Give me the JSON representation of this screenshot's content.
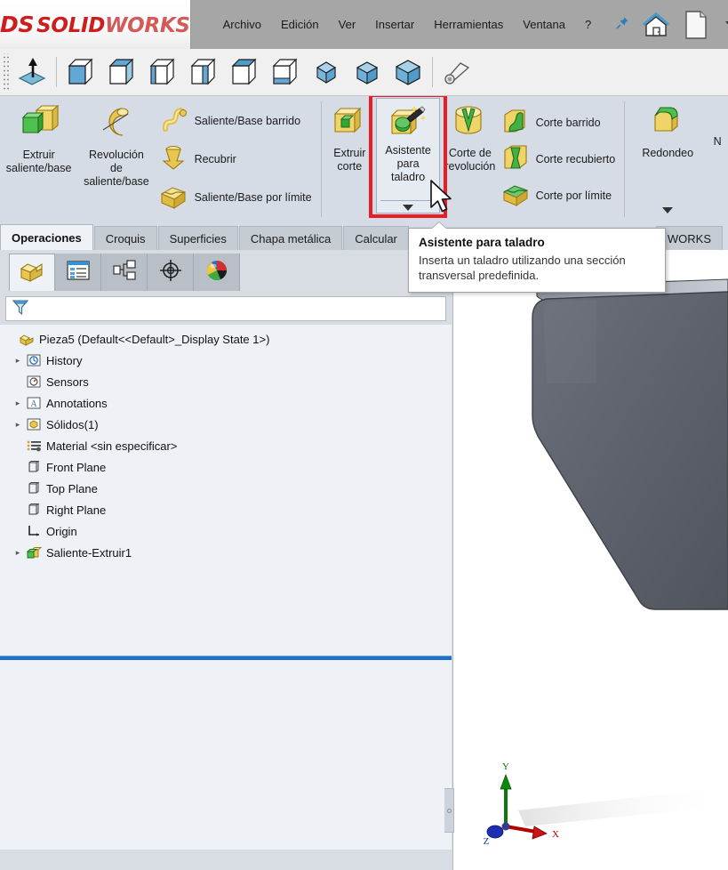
{
  "app": {
    "brand_ds": "DS",
    "brand_solid": "SOLID",
    "brand_works": "WORKS",
    "accent_red": "#cf1c1c",
    "highlight_red": "#ec1c24"
  },
  "menu": {
    "items": [
      {
        "label": "Archivo",
        "name": "menu-archivo"
      },
      {
        "label": "Edición",
        "name": "menu-edicion"
      },
      {
        "label": "Ver",
        "name": "menu-ver"
      },
      {
        "label": "Insertar",
        "name": "menu-insertar"
      },
      {
        "label": "Herramientas",
        "name": "menu-herramientas"
      },
      {
        "label": "Ventana",
        "name": "menu-ventana"
      },
      {
        "label": "?",
        "name": "menu-help"
      }
    ],
    "pin_icon": "pin-icon",
    "home_icon": "home-icon",
    "newdoc_icon": "new-document-icon",
    "dropdown_icon": "chevron-down-icon"
  },
  "view_toolbar": {
    "normal_to_icon": "normal-to-icon",
    "orientation_icons": [
      "view-front-icon",
      "view-back-icon",
      "view-left-icon",
      "view-right-icon",
      "view-top-icon",
      "view-bottom-icon",
      "view-iso-icon",
      "view-trimetric-icon",
      "view-dimetric-icon"
    ],
    "section_view_icon": "section-view-icon"
  },
  "ribbon": {
    "extrude_boss": {
      "label": "Extruir\nsaliente/base",
      "icon": "extrude-boss-icon"
    },
    "revolve_boss": {
      "label": "Revolución\nde\nsaliente/base",
      "icon": "revolve-boss-icon"
    },
    "swept_boss": {
      "label": "Saliente/Base barrido",
      "icon": "swept-boss-icon"
    },
    "lofted_boss": {
      "label": "Recubrir",
      "icon": "lofted-boss-icon"
    },
    "boundary_boss": {
      "label": "Saliente/Base por límite",
      "icon": "boundary-boss-icon"
    },
    "extruded_cut": {
      "label": "Extruir\ncorte",
      "icon": "extruded-cut-icon"
    },
    "hole_wizard": {
      "label_line1": "Asistente",
      "label_line2": "para",
      "label_line3": "taladro",
      "icon": "hole-wizard-icon",
      "dropdown_icon": "chevron-down-icon"
    },
    "revolved_cut": {
      "label": "Corte de\nrevolución",
      "icon": "revolved-cut-icon"
    },
    "swept_cut": {
      "label": "Corte barrido",
      "icon": "swept-cut-icon"
    },
    "lofted_cut": {
      "label": "Corte recubierto",
      "icon": "lofted-cut-icon"
    },
    "boundary_cut": {
      "label": "Corte por límite",
      "icon": "boundary-cut-icon"
    },
    "fillet": {
      "label": "Redondeo",
      "icon": "fillet-icon",
      "dropdown_icon": "chevron-down-icon"
    },
    "next_partial": {
      "label": "N"
    }
  },
  "tooltip": {
    "title": "Asistente para taladro",
    "body": "Inserta un taladro utilizando una sección transversal predefinida."
  },
  "command_tabs": {
    "items": [
      {
        "label": "Operaciones",
        "name": "tab-operaciones",
        "active": true
      },
      {
        "label": "Croquis",
        "name": "tab-croquis",
        "active": false
      },
      {
        "label": "Superficies",
        "name": "tab-superficies",
        "active": false
      },
      {
        "label": "Chapa metálica",
        "name": "tab-chapa-metalica",
        "active": false
      },
      {
        "label": "Calcular",
        "name": "tab-calcular",
        "active": false
      }
    ],
    "overflow_tab": "WORKS"
  },
  "feature_manager": {
    "tabs": [
      {
        "name": "tab-feature-tree",
        "icon": "feature-tree-icon",
        "active": true
      },
      {
        "name": "tab-property-manager",
        "icon": "property-manager-icon",
        "active": false
      },
      {
        "name": "tab-configuration-manager",
        "icon": "configuration-manager-icon",
        "active": false
      },
      {
        "name": "tab-dimxpert-manager",
        "icon": "dimxpert-icon",
        "active": false
      },
      {
        "name": "tab-display-manager",
        "icon": "display-manager-icon",
        "active": false
      }
    ],
    "filter": {
      "icon": "filter-icon",
      "placeholder": ""
    },
    "tree": [
      {
        "label": "Pieza5  (Default<<Default>_Display State 1>)",
        "icon": "part-icon",
        "twisty": "",
        "indent": 0
      },
      {
        "label": "History",
        "icon": "history-icon",
        "twisty": "▸",
        "indent": 1
      },
      {
        "label": "Sensors",
        "icon": "sensors-icon",
        "twisty": "",
        "indent": 1
      },
      {
        "label": "Annotations",
        "icon": "annotations-icon",
        "twisty": "▸",
        "indent": 1
      },
      {
        "label": "Sólidos(1)",
        "icon": "solid-bodies-icon",
        "twisty": "▸",
        "indent": 1
      },
      {
        "label": "Material <sin especificar>",
        "icon": "material-icon",
        "twisty": "",
        "indent": 1
      },
      {
        "label": "Front Plane",
        "icon": "plane-icon",
        "twisty": "",
        "indent": 1
      },
      {
        "label": "Top Plane",
        "icon": "plane-icon",
        "twisty": "",
        "indent": 1
      },
      {
        "label": "Right Plane",
        "icon": "plane-icon",
        "twisty": "",
        "indent": 1
      },
      {
        "label": "Origin",
        "icon": "origin-icon",
        "twisty": "",
        "indent": 1
      },
      {
        "label": "Saliente-Extruir1",
        "icon": "extrude-feature-icon",
        "twisty": "▸",
        "indent": 1
      }
    ]
  },
  "graphics": {
    "model_name": "extruded-plate-model",
    "model_color": "#5a5f69",
    "triad": {
      "x_label": "X",
      "y_label": "Y",
      "z_label": "Z",
      "x_color": "#c00000",
      "y_color": "#008000",
      "z_color": "#0000c0"
    }
  }
}
